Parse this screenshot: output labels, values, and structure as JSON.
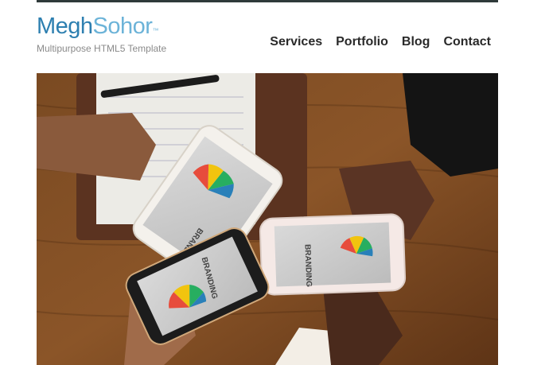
{
  "brand": {
    "name_part1": "Megh",
    "name_part2": "Sohor",
    "trademark": "™",
    "tagline": "Multipurpose HTML5 Template"
  },
  "nav": {
    "items": [
      {
        "label": "Services"
      },
      {
        "label": "Portfolio"
      },
      {
        "label": "Blog"
      },
      {
        "label": "Contact"
      }
    ]
  },
  "hero": {
    "phone_screen_text": "BRANDING"
  },
  "colors": {
    "brand_dark": "#2d7fb0",
    "brand_light": "#6cb3d8",
    "nav_text": "#2a2a2a",
    "top_bar": "#2f3a3a"
  }
}
